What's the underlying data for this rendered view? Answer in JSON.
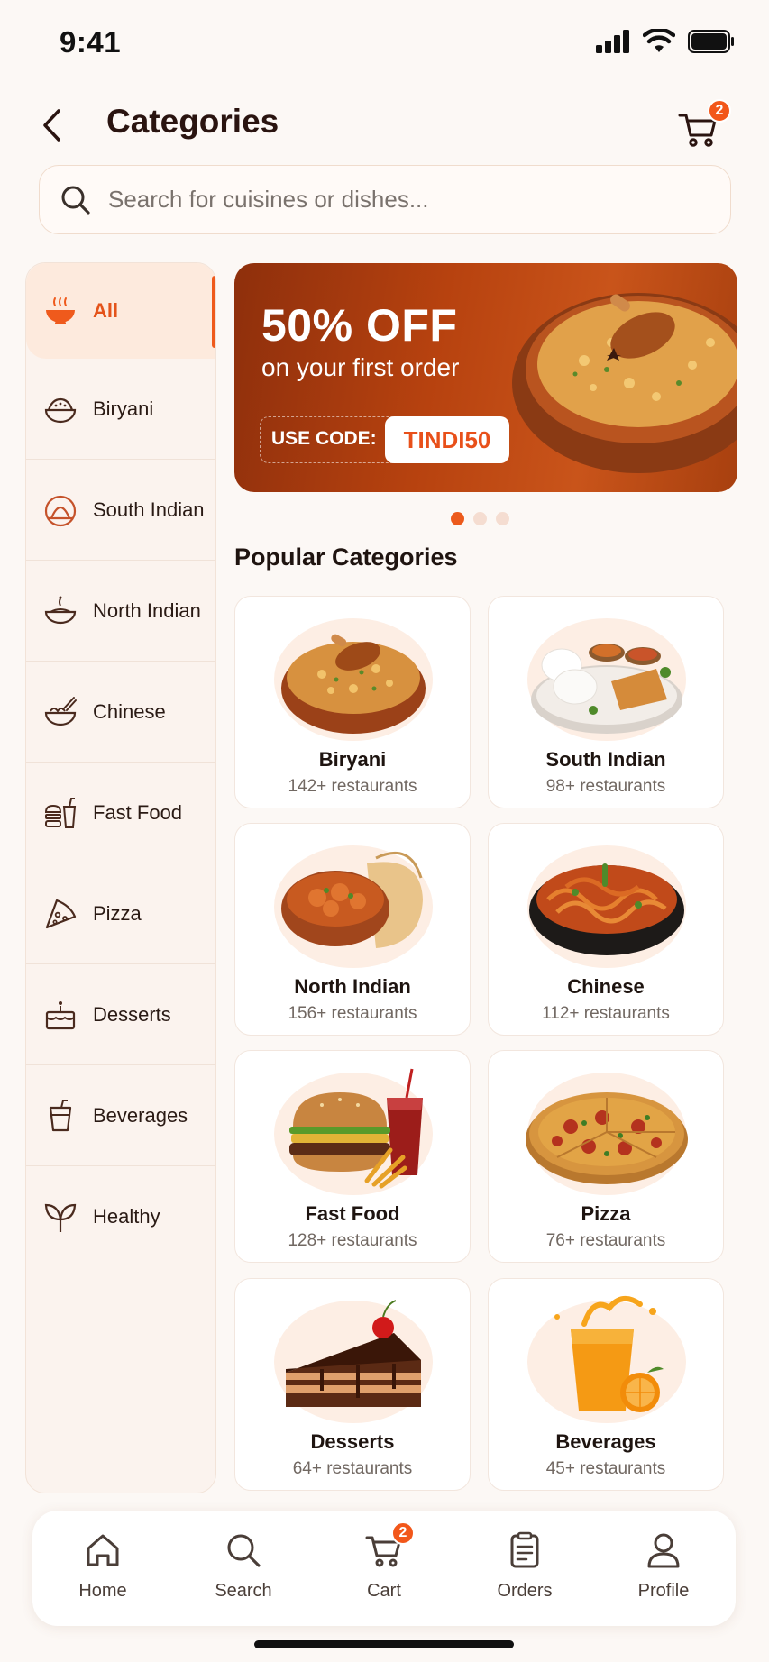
{
  "status_bar": {
    "time": "9:41"
  },
  "header": {
    "title": "Categories",
    "cart_count": "2"
  },
  "search": {
    "placeholder": "Search for cuisines or dishes..."
  },
  "sidebar": {
    "items": [
      {
        "label": "All",
        "icon": "bowl-icon",
        "active": true
      },
      {
        "label": "Biryani",
        "icon": "biryani-icon"
      },
      {
        "label": "South Indian",
        "icon": "dosa-icon"
      },
      {
        "label": "North Indian",
        "icon": "curry-bowl-icon"
      },
      {
        "label": "Chinese",
        "icon": "noodles-icon"
      },
      {
        "label": "Fast Food",
        "icon": "burger-drink-icon"
      },
      {
        "label": "Pizza",
        "icon": "pizza-slice-icon"
      },
      {
        "label": "Desserts",
        "icon": "cake-icon"
      },
      {
        "label": "Beverages",
        "icon": "cup-icon"
      },
      {
        "label": "Healthy",
        "icon": "leaf-icon"
      }
    ]
  },
  "banner": {
    "headline": "50% OFF",
    "subline": "on your first order",
    "code_label": "USE CODE:",
    "code_value": "TINDI50",
    "slides": 3,
    "active_slide": 1
  },
  "popular": {
    "title": "Popular Categories",
    "cards": [
      {
        "name": "Biryani",
        "count": "142+ restaurants"
      },
      {
        "name": "South Indian",
        "count": "98+ restaurants"
      },
      {
        "name": "North Indian",
        "count": "156+ restaurants"
      },
      {
        "name": "Chinese",
        "count": "112+ restaurants"
      },
      {
        "name": "Fast Food",
        "count": "128+ restaurants"
      },
      {
        "name": "Pizza",
        "count": "76+ restaurants"
      },
      {
        "name": "Desserts",
        "count": "64+ restaurants"
      },
      {
        "name": "Beverages",
        "count": "45+ restaurants"
      }
    ]
  },
  "bottom_nav": {
    "items": [
      {
        "label": "Home",
        "icon": "home-icon"
      },
      {
        "label": "Search",
        "icon": "search-icon"
      },
      {
        "label": "Cart",
        "icon": "cart-icon",
        "badge": "2"
      },
      {
        "label": "Orders",
        "icon": "orders-icon"
      },
      {
        "label": "Profile",
        "icon": "profile-icon"
      }
    ]
  },
  "colors": {
    "accent": "#ef5a1c",
    "background": "#fcf8f5",
    "banner": "#b7420f"
  }
}
